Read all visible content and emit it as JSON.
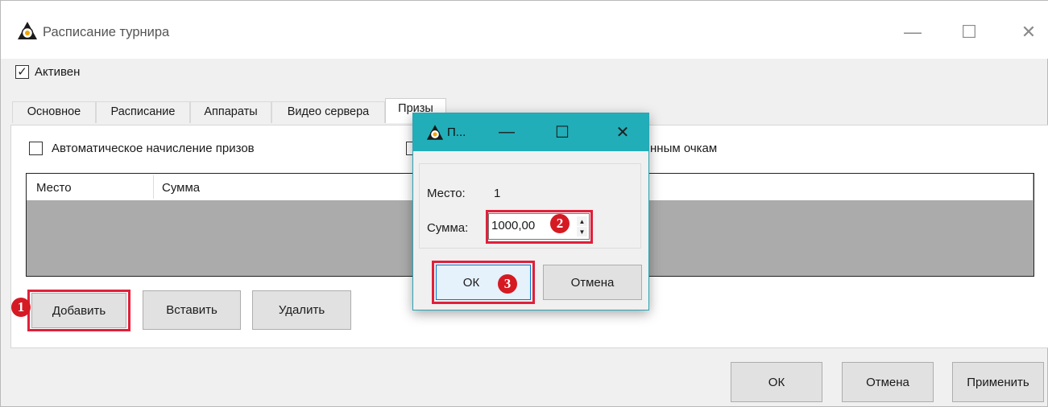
{
  "window": {
    "title": "Расписание турнира",
    "minimize_glyph": "—",
    "maximize_glyph": "☐",
    "close_glyph": "✕"
  },
  "active_checkbox": {
    "label": "Активен",
    "checked": true,
    "mark": "✓"
  },
  "tabs": [
    {
      "label": "Основное"
    },
    {
      "label": "Расписание"
    },
    {
      "label": "Аппараты"
    },
    {
      "label": "Видео сервера"
    },
    {
      "label": "Призы"
    }
  ],
  "prizes_panel": {
    "auto_prizes_label": "Автоматическое начисление призов",
    "second_checkbox_label": "нным очкам",
    "list_headers": [
      "Место",
      "Сумма"
    ],
    "buttons": {
      "add": "Добавить",
      "insert": "Вставить",
      "delete": "Удалить"
    }
  },
  "footer_buttons": {
    "ok": "ОК",
    "cancel": "Отмена",
    "apply": "Применить"
  },
  "dialog": {
    "title": "П...",
    "minimize_glyph": "—",
    "maximize_glyph": "☐",
    "close_glyph": "✕",
    "place_label": "Место:",
    "place_value": "1",
    "sum_label": "Сумма:",
    "sum_value": "1000,00",
    "ok": "ОК",
    "cancel": "Отмена",
    "arrow_up": "▲",
    "arrow_down": "▼"
  },
  "annotations": {
    "step1": "1",
    "step2": "2",
    "step3": "3"
  },
  "colors": {
    "highlight_red": "#e0203a",
    "badge_red": "#d51a24",
    "dialog_titlebar": "#21aeb8",
    "list_fill": "#ababab"
  }
}
